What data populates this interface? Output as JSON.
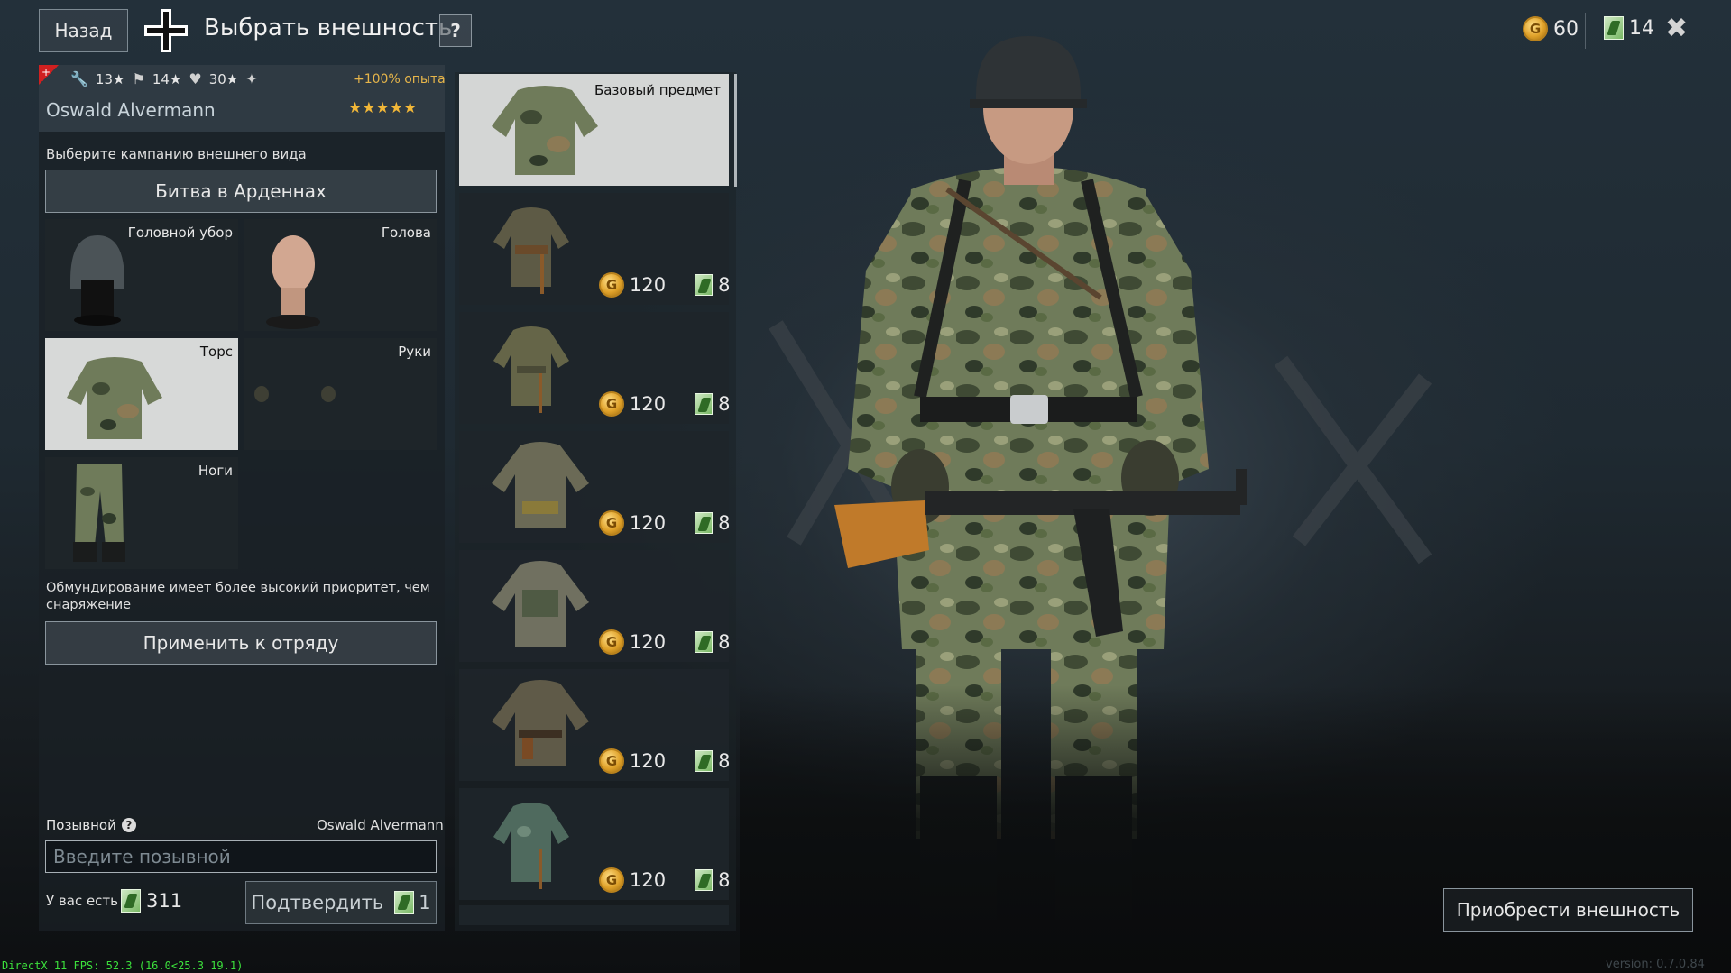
{
  "header": {
    "back_label": "Назад",
    "title": "Выбрать внешность",
    "help_label": "?",
    "gold": "60",
    "tokens": "14",
    "close_label": "✖"
  },
  "soldier": {
    "stat1": "13",
    "stat2": "14",
    "stat3": "30",
    "exp_bonus": "+100% опыта",
    "name": "Oswald Alvermann",
    "stars": "★★★★★"
  },
  "campaign": {
    "label": "Выберите кампанию внешнего вида",
    "selected": "Битва в Арденнах"
  },
  "slots": {
    "headwear": "Головной убор",
    "head": "Голова",
    "torso": "Торс",
    "hands": "Руки",
    "legs": "Ноги"
  },
  "priority_note": "Обмундирование имеет более высокий приоритет, чем снаряжение",
  "apply_label": "Применить к отряду",
  "callsign": {
    "label": "Позывной",
    "current": "Oswald Alvermann",
    "placeholder": "Введите позывной",
    "have_label": "У вас есть",
    "have_value": "311",
    "confirm_label": "Подтвердить",
    "confirm_cost": "1"
  },
  "items": {
    "base_label": "Базовый предмет",
    "list": [
      {
        "gold": "120",
        "tokens": "8"
      },
      {
        "gold": "120",
        "tokens": "8"
      },
      {
        "gold": "120",
        "tokens": "8"
      },
      {
        "gold": "120",
        "tokens": "8"
      },
      {
        "gold": "120",
        "tokens": "8"
      },
      {
        "gold": "120",
        "tokens": "8"
      }
    ]
  },
  "coin_letter": "G",
  "buy_label": "Приобрести внешность",
  "fps_text": "DirectX 11 FPS: 52.3 (16.0<25.3 19.1)",
  "version_text": "version: 0.7.0.84",
  "colors": {
    "gold": "#e6b54a",
    "accent_border": "#8a959d",
    "fps": "#3ce03c"
  }
}
